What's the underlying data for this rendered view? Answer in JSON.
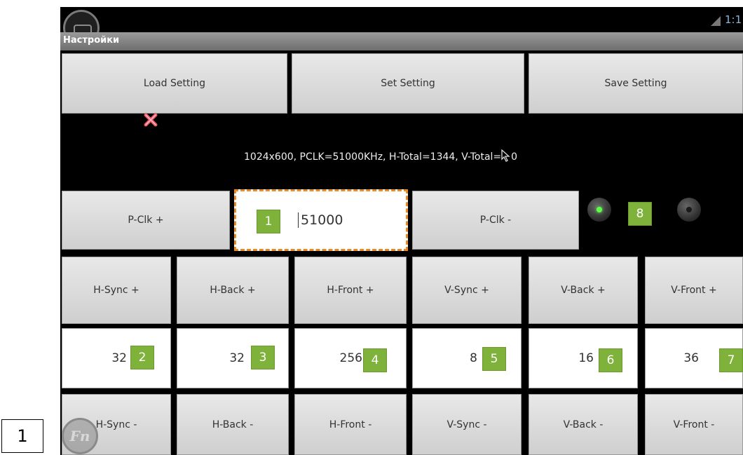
{
  "title_bar": {
    "title": "Настройки",
    "status_time": "1:1"
  },
  "top_buttons": {
    "load": "Load Setting",
    "set": "Set Setting",
    "save": "Save Setting"
  },
  "info_text": "1024x600,  PCLK=51000KHz,  H-Total=1344,  V-Total=",
  "info_tail": "0",
  "pclk": {
    "plus": "P-Clk +",
    "minus": "P-Clk -",
    "value": "51000"
  },
  "plus_row": [
    "H-Sync +",
    "H-Back +",
    "H-Front +",
    "V-Sync +",
    "V-Back +",
    "V-Front +"
  ],
  "values_row": [
    "32",
    "32",
    "256",
    "8",
    "16",
    "36"
  ],
  "minus_row": [
    "H-Sync -",
    "H-Back -",
    "H-Front -",
    "V-Sync -",
    "V-Back -",
    "V-Front -"
  ],
  "callouts": [
    "1",
    "2",
    "3",
    "4",
    "5",
    "6",
    "7",
    "8"
  ],
  "page_label": "1",
  "fn_label": "Fn",
  "colors": {
    "radio_on": "#5cff4a",
    "radio_off": "#1a1a1a",
    "callout": "#7fb23a"
  }
}
